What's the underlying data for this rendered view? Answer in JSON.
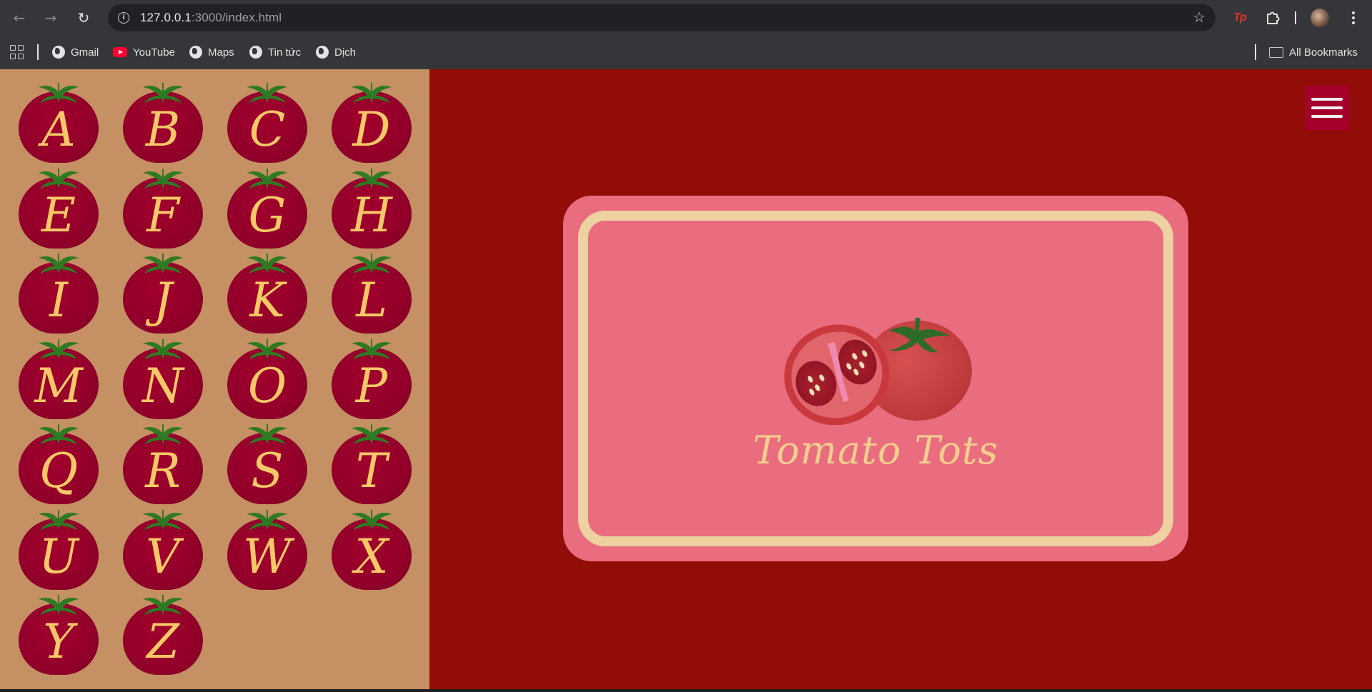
{
  "browser": {
    "url_host": "127.0.0.1",
    "url_path": ":3000/index.html",
    "bookmarks": [
      {
        "label": "Gmail",
        "icon": "globe-icon"
      },
      {
        "label": "YouTube",
        "icon": "youtube-icon"
      },
      {
        "label": "Maps",
        "icon": "globe-icon"
      },
      {
        "label": "Tin tức",
        "icon": "globe-icon"
      },
      {
        "label": "Dịch",
        "icon": "globe-icon"
      }
    ],
    "all_bookmarks_label": "All Bookmarks",
    "extension_label": "Tp"
  },
  "sidebar": {
    "letters": [
      "A",
      "B",
      "C",
      "D",
      "E",
      "F",
      "G",
      "H",
      "I",
      "J",
      "K",
      "L",
      "M",
      "N",
      "O",
      "P",
      "Q",
      "R",
      "S",
      "T",
      "U",
      "V",
      "W",
      "X",
      "Y",
      "Z"
    ]
  },
  "main": {
    "title": "Tomato Tots"
  },
  "colors": {
    "page_background": "#930d08",
    "sidebar_background": "#c49064",
    "tomato_tile": "#92002a",
    "letter_color": "#f7c867",
    "card_background": "#e96d7f",
    "card_frame": "#edd1a1",
    "title_color": "#f4cd8f",
    "menu_button": "#a4002c"
  }
}
